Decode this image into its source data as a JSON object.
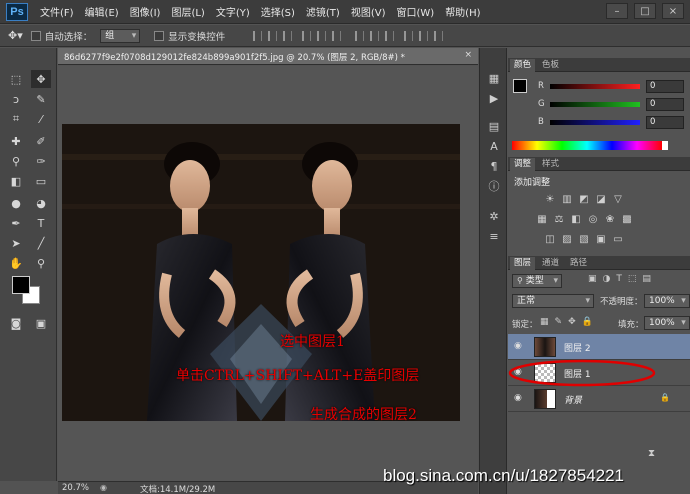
{
  "app": {
    "logo": "Ps"
  },
  "menu": [
    "文件(F)",
    "编辑(E)",
    "图像(I)",
    "图层(L)",
    "文字(Y)",
    "选择(S)",
    "滤镜(T)",
    "视图(V)",
    "窗口(W)",
    "帮助(H)"
  ],
  "window_controls": [
    "–",
    "□",
    "×"
  ],
  "options_bar": {
    "auto_select_label": "自动选择：",
    "auto_select_value": "组",
    "show_transform_label": "显示变换控件"
  },
  "document": {
    "tab_title": "86d6277f9e2f0708d129012fe824b899a901f2f5.jpg @ 20.7% (图层 2, RGB/8#) *",
    "close_glyph": "×",
    "zoom": "20.7%",
    "doc_size": "文档:14.1M/29.2M"
  },
  "annotations": {
    "line1": "选中图层1",
    "line2": "单击CTRL+SHIFT+ALT+E盖印图层",
    "line3": "生成合成的图层2"
  },
  "color_panel": {
    "tabs": [
      "颜色",
      "色板"
    ],
    "channels": [
      {
        "label": "R",
        "value": "0",
        "color": "#ff2020"
      },
      {
        "label": "G",
        "value": "0",
        "color": "#20c020"
      },
      {
        "label": "B",
        "value": "0",
        "color": "#2020ff"
      }
    ]
  },
  "adjust_panel": {
    "tabs": [
      "调整",
      "样式"
    ],
    "title": "添加调整"
  },
  "layers_panel": {
    "tabs": [
      "图层",
      "通道",
      "路径"
    ],
    "filter_kind": "类型",
    "blend_mode": "正常",
    "opacity_label": "不透明度：",
    "opacity_value": "100%",
    "lock_label": "锁定：",
    "fill_label": "填充：",
    "fill_value": "100%",
    "layers": [
      {
        "name": "图层 2",
        "selected": true
      },
      {
        "name": "图层 1",
        "selected": false
      },
      {
        "name": "背景",
        "selected": false
      }
    ]
  },
  "watermark": "blog.sina.com.cn/u/1827854221"
}
